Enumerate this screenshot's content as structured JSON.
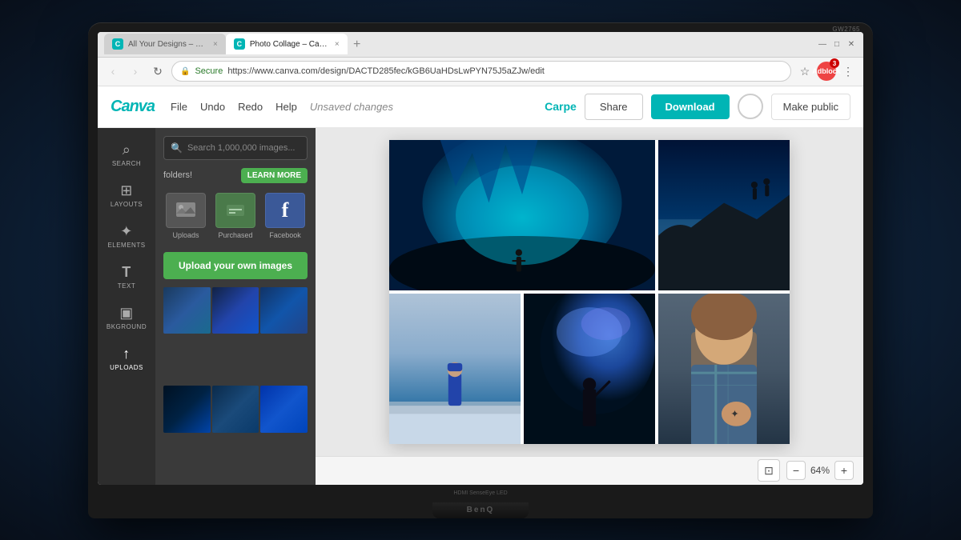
{
  "monitor": {
    "model": "GW2765",
    "brand": "BenQ",
    "port_label": "HDMI SenseEye LED"
  },
  "browser": {
    "tabs": [
      {
        "id": "tab1",
        "label": "All Your Designs – Canva",
        "active": false,
        "favicon_color": "#00b5b5"
      },
      {
        "id": "tab2",
        "label": "Photo Collage – Carpe",
        "active": true,
        "favicon_color": "#00b5b5"
      }
    ],
    "address": "https://www.canva.com/design/DACTD285fec/kGB6UaHDsLwPYN75J5aZJw/edit",
    "secure_label": "Secure"
  },
  "canva": {
    "logo": "Canva",
    "nav": [
      "File",
      "Undo",
      "Redo",
      "Help"
    ],
    "status": "Unsaved changes",
    "user": "Carpe",
    "share_label": "Share",
    "download_label": "Download",
    "make_public_label": "Make public",
    "sidebar": [
      {
        "id": "search",
        "label": "SEARCH",
        "icon": "🔍"
      },
      {
        "id": "layouts",
        "label": "LAYOUTS",
        "icon": "⊞"
      },
      {
        "id": "elements",
        "label": "ELEMENTS",
        "icon": "✦"
      },
      {
        "id": "text",
        "label": "TEXT",
        "icon": "T"
      },
      {
        "id": "bkground",
        "label": "BKGROUND",
        "icon": "🖼"
      },
      {
        "id": "uploads",
        "label": "UPLOADS",
        "icon": "↑"
      }
    ],
    "panel": {
      "search_placeholder": "Search 1,000,000 images...",
      "folders_text": "folders!",
      "learn_more_label": "LEARN MORE",
      "sources": [
        {
          "id": "uploads",
          "label": "Uploads",
          "icon": "🖼"
        },
        {
          "id": "purchased",
          "label": "Purchased",
          "icon": "💳"
        },
        {
          "id": "facebook",
          "label": "Facebook",
          "icon": "f"
        }
      ],
      "upload_btn_label": "Upload your own images",
      "images": [
        {
          "id": "img1",
          "color": "#1a4a6e"
        },
        {
          "id": "img2",
          "color": "#2244aa"
        },
        {
          "id": "img3",
          "color": "#113366"
        },
        {
          "id": "img4",
          "color": "#001122"
        },
        {
          "id": "img5",
          "color": "#0a3a5a"
        },
        {
          "id": "img6",
          "color": "#1155aa"
        }
      ]
    },
    "canvas": {
      "zoom": "64%",
      "photos": [
        {
          "id": "ice-cave",
          "span": 2,
          "color_from": "#0a4a6e",
          "color_to": "#00c8d8",
          "row": 1
        },
        {
          "id": "mountain",
          "span": 1,
          "color_from": "#001a44",
          "color_to": "#4488aa",
          "row": 1
        },
        {
          "id": "snowy-field",
          "span": 1,
          "color_from": "#b8c8d8",
          "color_to": "#224466",
          "row": 2
        },
        {
          "id": "smoke-blue",
          "span": 1,
          "color_from": "#001122",
          "color_to": "#2266cc",
          "row": 2
        },
        {
          "id": "girl-tattoo",
          "span": 1,
          "color_from": "#334455",
          "color_to": "#223344",
          "row": 2
        }
      ]
    },
    "bottom": {
      "zoom_label": "64%",
      "zoom_minus": "−",
      "zoom_plus": "+"
    }
  }
}
